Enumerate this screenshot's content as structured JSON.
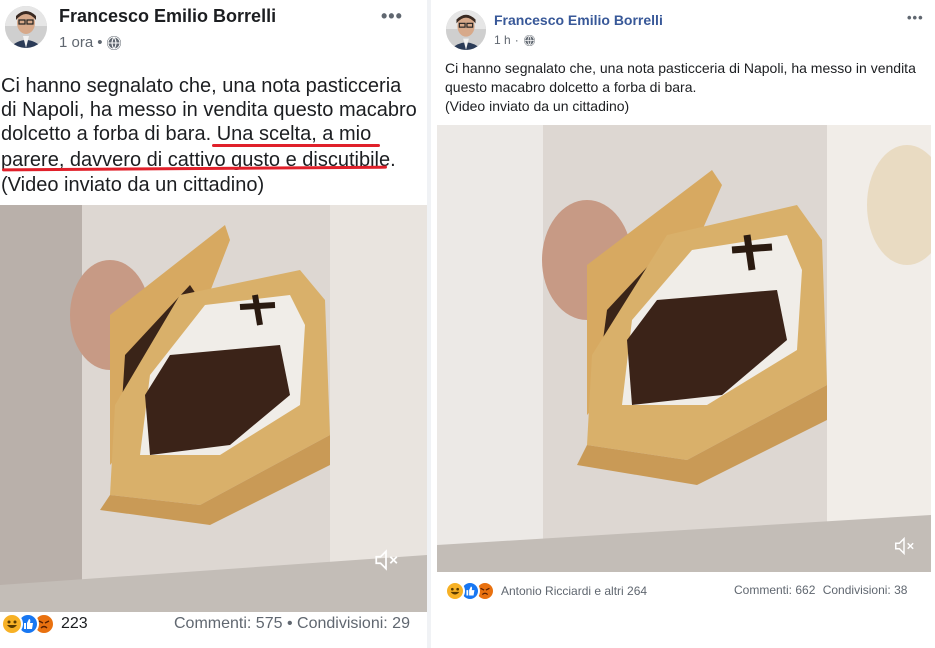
{
  "left_post": {
    "author": "Francesco Emilio Borrelli",
    "timestamp": "1 ora",
    "separator": "•",
    "privacy_icon": "globe-icon",
    "more_icon": "•••",
    "text_line1": "Ci hanno segnalato che, una nota pasticceria",
    "text_line2": "di Napoli, ha messo in vendita questo macabro",
    "text_line3_plain": "dolcetto a forba di bara. ",
    "text_line3_underlined": "Una scelta, a mio",
    "text_line4_underlined": "parere, davvero di cattivo gusto e discutibile.",
    "text_line5": "(Video inviato da un cittadino)",
    "mute_icon": "🔇",
    "reactions_count": "223",
    "comments": "Commenti: 575",
    "shares_separator": "•",
    "shares": "Condivisioni: 29"
  },
  "right_post": {
    "author": "Francesco Emilio Borrelli",
    "timestamp": "1 h",
    "separator": "·",
    "privacy_icon": "globe-icon",
    "more_icon": "•••",
    "text_line1": "Ci hanno segnalato che, una nota pasticceria di Napoli, ha messo in vendita",
    "text_line2": "questo macabro dolcetto a forba di bara.",
    "text_line3": "(Video inviato da un cittadino)",
    "mute_icon": "🔇",
    "reactions_text": "Antonio Ricciardi e altri 264",
    "comments": "Commenti: 662",
    "shares": "Condivisioni: 38"
  },
  "colors": {
    "author_right": "#385898",
    "underline": "#e0202a",
    "haha": "#f7b125",
    "like": "#1877f2",
    "angry": "#e9710f"
  }
}
